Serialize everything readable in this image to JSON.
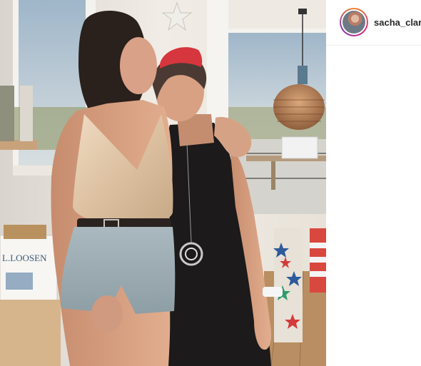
{
  "post": {
    "username": "sacha_clare",
    "avatar_icon": "profile-avatar-icon",
    "image_box_label": "L.LOOSEN"
  },
  "colors": {
    "avatar_ring": [
      "#f58529",
      "#dd2a7b",
      "#8134af"
    ],
    "username_text": "#262626"
  }
}
